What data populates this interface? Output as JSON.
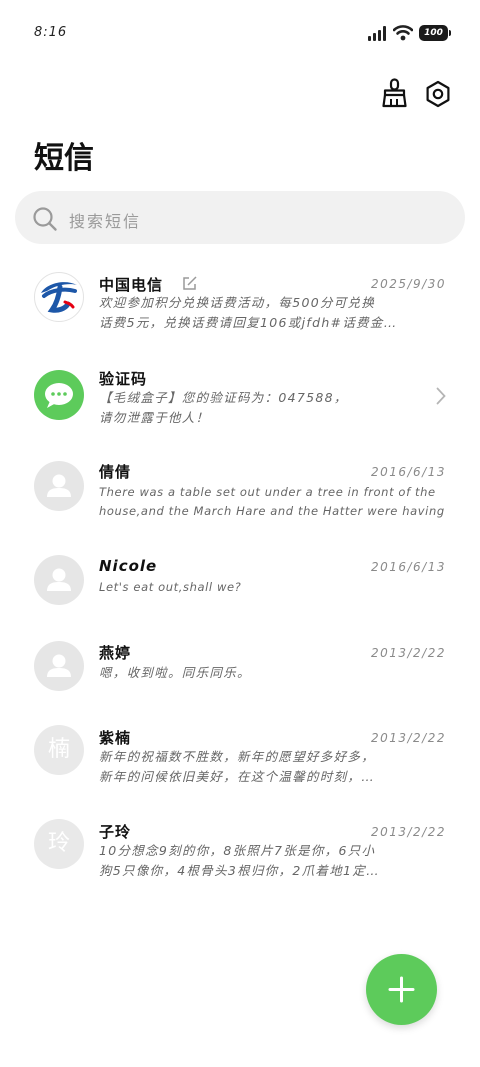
{
  "status_bar": {
    "time": "8:16",
    "battery": "100"
  },
  "header": {
    "title": "短信"
  },
  "search": {
    "placeholder": "搜索短信"
  },
  "messages": [
    {
      "name": "中国电信",
      "date": "2025/9/30",
      "line1": "欢迎参加积分兑换话费活动，每500分可兑换",
      "line2": "话费5元，兑换话费请回复106或jfdh#话费金…"
    },
    {
      "name": "验证码",
      "date": "",
      "line1": "【毛绒盒子】您的验证码为：047588，",
      "line2": "请勿泄露于他人！"
    },
    {
      "name": "倩倩",
      "date": "2016/6/13",
      "line1": "There was a table set out under a tree in front of the",
      "line2": "house,and the March Hare and the Hatter were having tea …"
    },
    {
      "name": "Nicole",
      "date": "2016/6/13",
      "line1": "Let's eat out,shall we?",
      "line2": ""
    },
    {
      "name": "燕婷",
      "date": "2013/2/22",
      "line1": "嗯，收到啦。同乐同乐。",
      "line2": ""
    },
    {
      "name": "紫楠",
      "date": "2013/2/22",
      "line1": "新年的祝福数不胜数，新年的愿望好多好多，",
      "line2": "新年的问候依旧美好，在这个温馨的时刻，…",
      "avatar_char": "楠"
    },
    {
      "name": "子玲",
      "date": "2013/2/22",
      "line1": "10分想念9刻的你，8张照片7张是你，6只小",
      "line2": "狗5只像你，4根骨头3根归你，2爪着地1定…",
      "avatar_char": "玲"
    }
  ],
  "colors": {
    "accent": "#5dcb5b",
    "telecom_blue": "#1d57a8",
    "telecom_red": "#e60012"
  }
}
